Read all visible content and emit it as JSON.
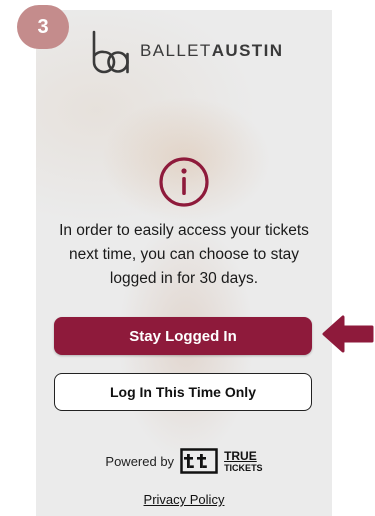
{
  "step": {
    "number": "3"
  },
  "logo": {
    "part1": "BALLET",
    "part2": "AUSTIN"
  },
  "message": "In order to easily access your tickets next time, you can choose to stay logged in for 30 days.",
  "buttons": {
    "primary": "Stay Logged In",
    "secondary": "Log In This Time Only"
  },
  "footer": {
    "powered_by": "Powered by",
    "brand_line1": "TRUE",
    "brand_line2": "TICKETS",
    "privacy": "Privacy Policy"
  },
  "colors": {
    "brand": "#8e1a3b",
    "badge": "#c48c8c",
    "arrow": "#8e1a3b"
  },
  "icons": [
    "info-icon",
    "ballet-austin-logo-mark",
    "true-tickets-logo-icon",
    "arrow-left-icon"
  ]
}
